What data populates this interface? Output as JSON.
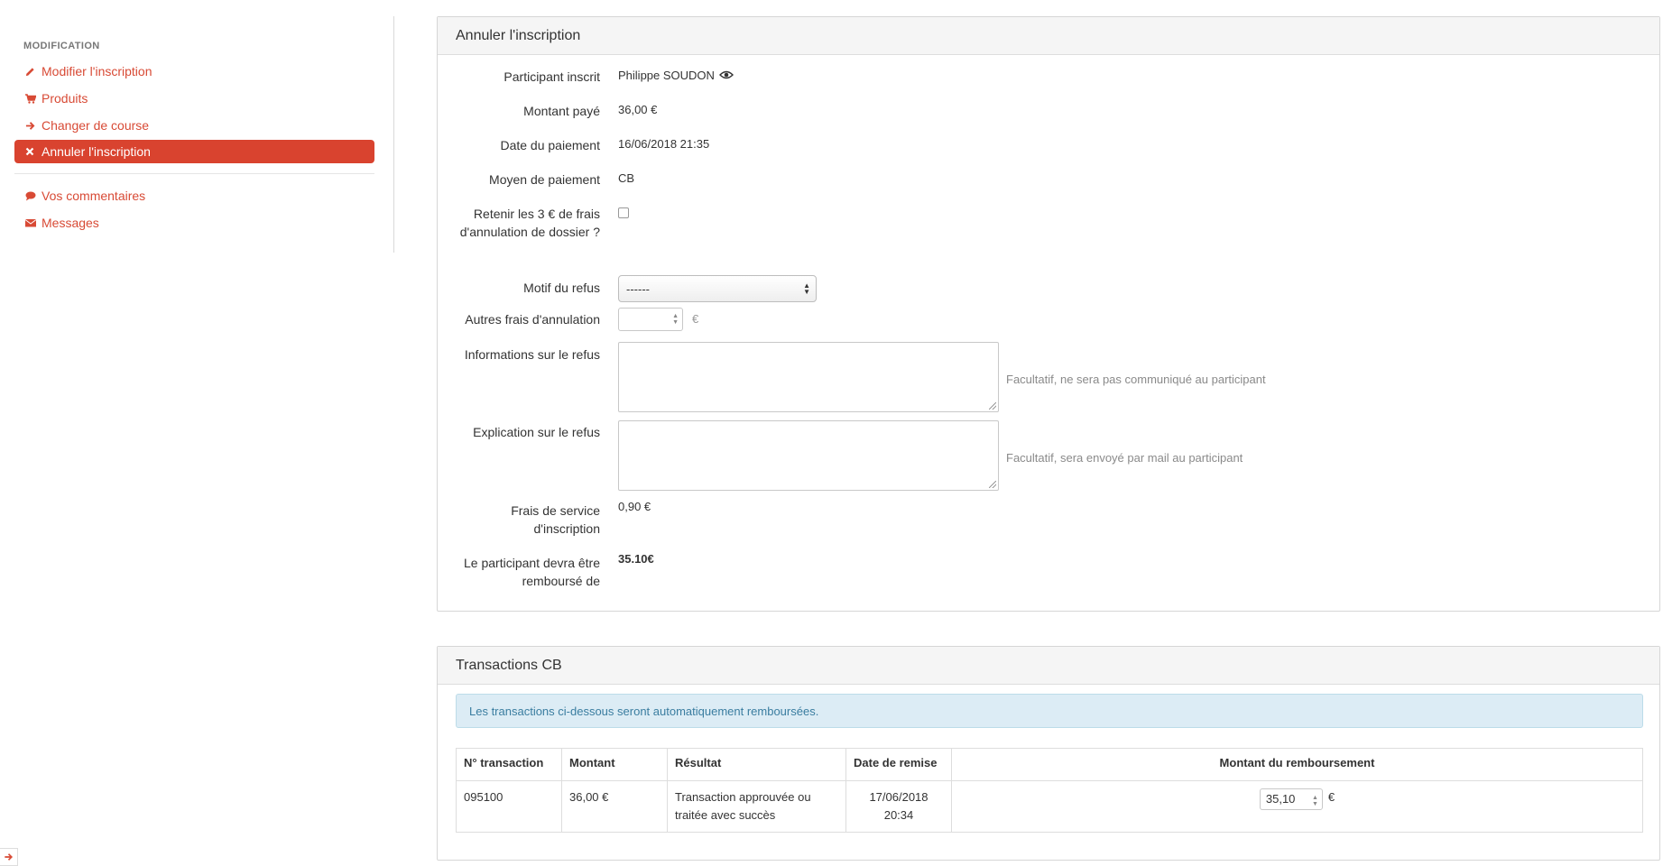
{
  "sidebar": {
    "heading": "MODIFICATION",
    "items": [
      {
        "label": "Modifier l'inscription",
        "icon": "pencil-icon"
      },
      {
        "label": "Produits",
        "icon": "cart-icon"
      },
      {
        "label": "Changer de course",
        "icon": "arrow-right-icon"
      },
      {
        "label": "Annuler l'inscription",
        "icon": "close-icon",
        "active": true
      }
    ],
    "items2": [
      {
        "label": "Vos commentaires",
        "icon": "comment-icon"
      },
      {
        "label": "Messages",
        "icon": "envelope-icon"
      }
    ]
  },
  "cancel_panel": {
    "title": "Annuler l'inscription",
    "participant_label": "Participant inscrit",
    "participant_value": "Philippe SOUDON",
    "amount_label": "Montant payé",
    "amount_value": "36,00 €",
    "date_label": "Date du paiement",
    "date_value": "16/06/2018 21:35",
    "method_label": "Moyen de paiement",
    "method_value": "CB",
    "retain_label": "Retenir les 3 € de frais d'annulation de dossier ?",
    "retain_checked": false,
    "reason_label": "Motif du refus",
    "reason_value": "------",
    "other_fees_label": "Autres frais d'annulation",
    "other_fees_unit": "€",
    "info_label": "Informations sur le refus",
    "info_help": "Facultatif, ne sera pas communiqué au participant",
    "explanation_label": "Explication sur le refus",
    "explanation_help": "Facultatif, sera envoyé par mail au participant",
    "service_fee_label": "Frais de service d'inscription",
    "service_fee_value": "0,90 €",
    "refund_label": "Le participant devra être remboursé de",
    "refund_value": "35.10€"
  },
  "transactions_panel": {
    "title": "Transactions CB",
    "alert": "Les transactions ci-dessous seront automatiquement remboursées.",
    "headers": [
      "N° transaction",
      "Montant",
      "Résultat",
      "Date de remise",
      "Montant du remboursement"
    ],
    "row": {
      "id": "095100",
      "amount": "36,00 €",
      "result": "Transaction approuvée ou traitée avec succès",
      "date": "17/06/2018 20:34",
      "refund_input": "35,10",
      "refund_unit": "€"
    }
  },
  "colors": {
    "accent": "#d9432f",
    "link": "#d84a35",
    "alert_bg": "#dcecf5",
    "alert_text": "#3a7da0"
  }
}
